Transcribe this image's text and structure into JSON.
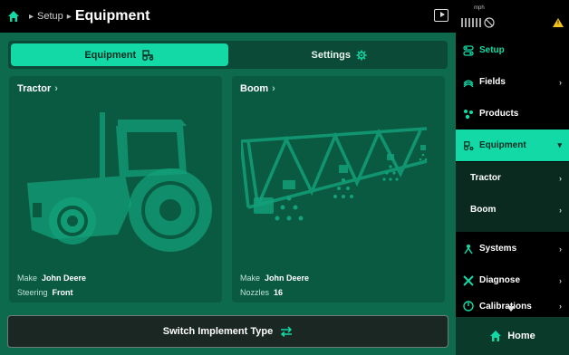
{
  "header": {
    "breadcrumb": "Setup",
    "title": "Equipment"
  },
  "tabs": [
    {
      "label": "Equipment",
      "active": true,
      "icon": "tractor-icon"
    },
    {
      "label": "Settings",
      "active": false,
      "icon": "gear-icon"
    }
  ],
  "cards": {
    "tractor": {
      "title": "Tractor",
      "make_label": "Make",
      "make_value": "John Deere",
      "steering_label": "Steering",
      "steering_value": "Front"
    },
    "boom": {
      "title": "Boom",
      "make_label": "Make",
      "make_value": "John Deere",
      "nozzles_label": "Nozzles",
      "nozzles_value": "16"
    }
  },
  "switch_button": {
    "label": "Switch Implement Type"
  },
  "status": {
    "speed_text": "mph"
  },
  "sidebar": {
    "items": [
      {
        "label": "Setup"
      },
      {
        "label": "Fields"
      },
      {
        "label": "Products"
      },
      {
        "label": "Equipment"
      },
      {
        "label": "Tractor"
      },
      {
        "label": "Boom"
      },
      {
        "label": "Systems"
      },
      {
        "label": "Diagnose"
      },
      {
        "label": "Calibrations"
      }
    ],
    "home_label": "Home"
  },
  "colors": {
    "accent": "#13d9a6",
    "panel": "#0e6a4d",
    "card": "#0a5a41",
    "warning": "#f2c21b"
  }
}
